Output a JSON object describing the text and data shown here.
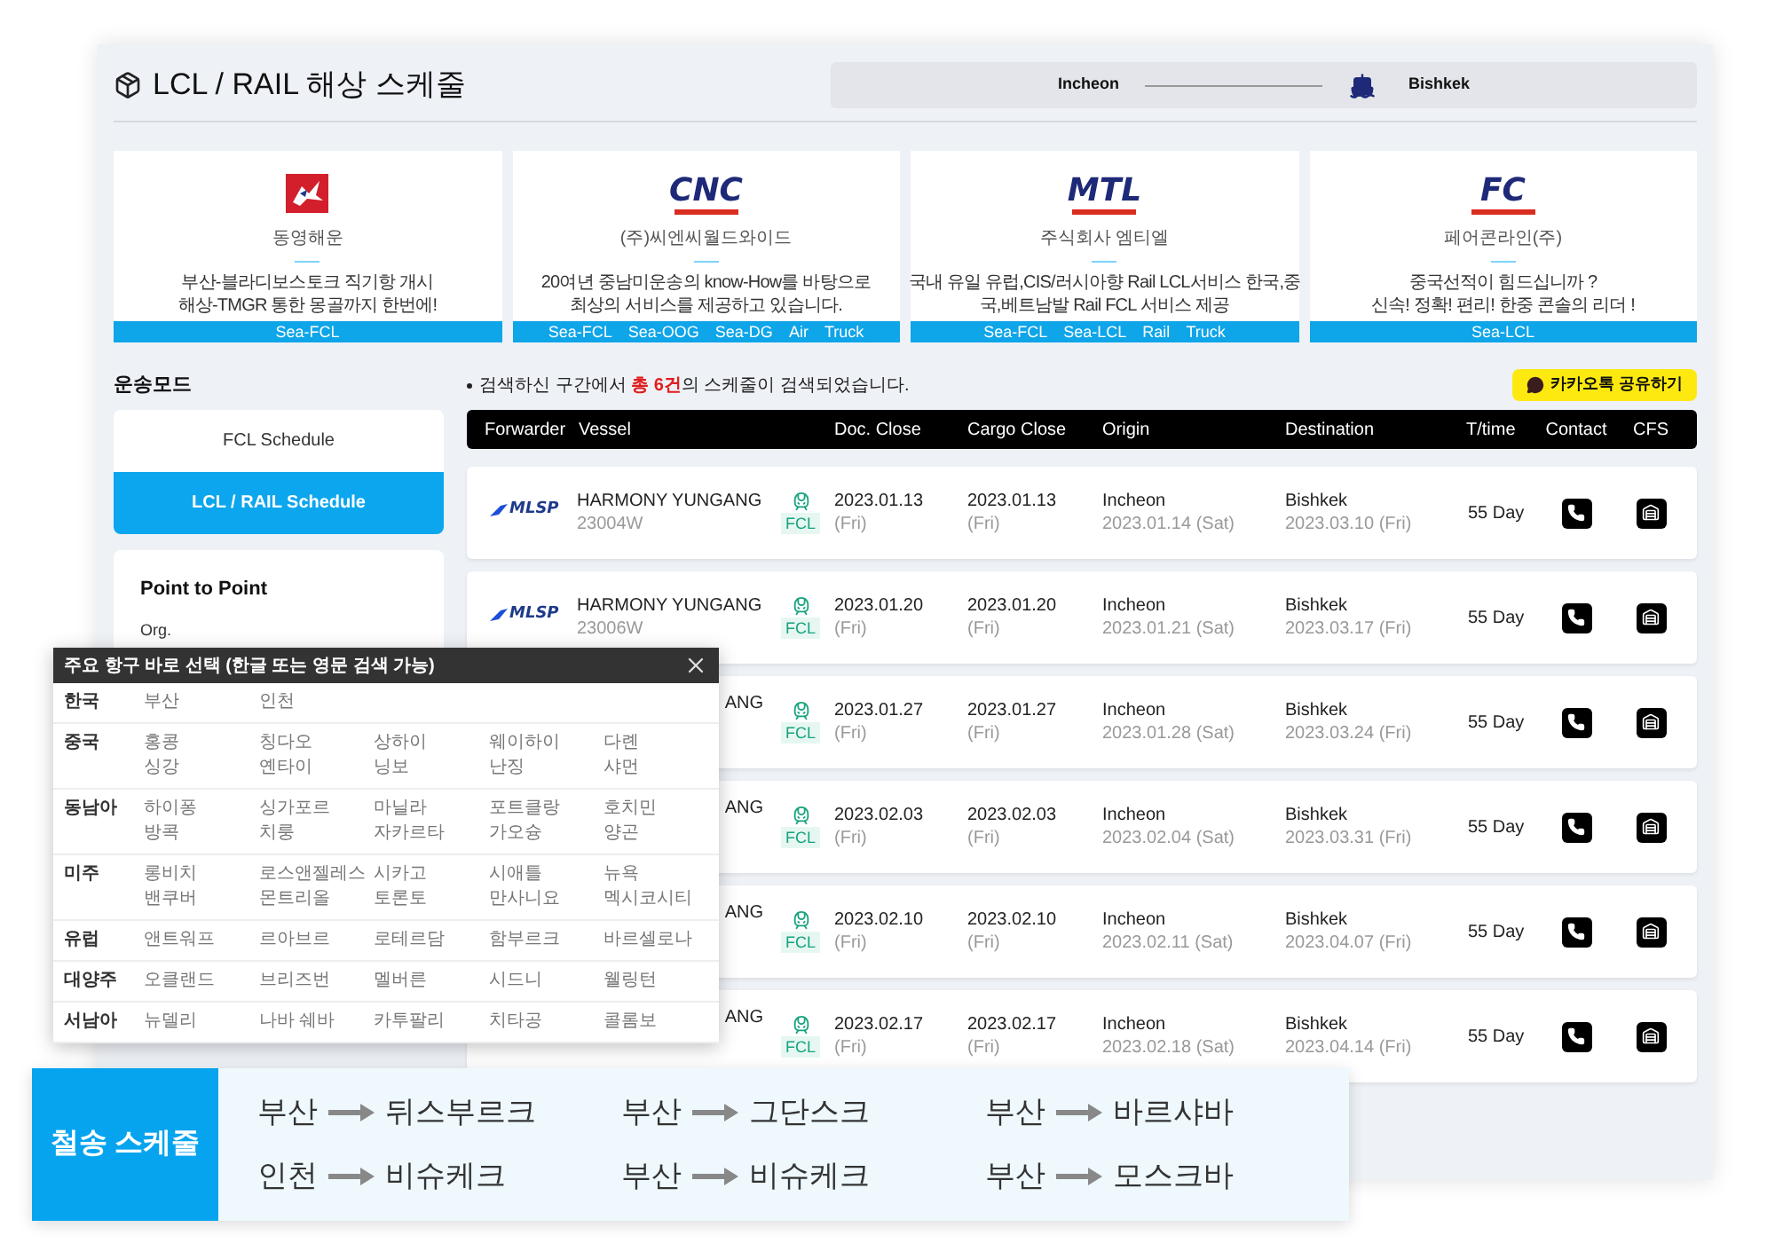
{
  "title": "LCL / RAIL 해상 스케줄",
  "route": {
    "origin": "Incheon",
    "destination": "Bishkek"
  },
  "carriers": [
    {
      "kind": "emblem",
      "name": "동영해운",
      "description": "부산-블라디보스토크 직기항 개시\n해상-TMGR 통한 몽골까지 한번에!",
      "tags": [
        "Sea-FCL"
      ]
    },
    {
      "kind": "wordmark",
      "logo_text": "CNC",
      "name": "(주)씨엔씨월드와이드",
      "description": "20여년 중남미운송의 know-How를 바탕으로\n최상의 서비스를 제공하고 있습니다.",
      "tags": [
        "Sea-FCL",
        "Sea-OOG",
        "Sea-DG",
        "Air",
        "Truck"
      ]
    },
    {
      "kind": "wordmark",
      "logo_text": "MTL",
      "name": "주식회사 엠티엘",
      "description": "국내 유일 유럽,CIS/러시아향 Rail LCL서비스 한국,중\n국,베트남발 Rail FCL 서비스 제공",
      "tags": [
        "Sea-FCL",
        "Sea-LCL",
        "Rail",
        "Truck"
      ]
    },
    {
      "kind": "wordmark",
      "logo_text": "FC",
      "name": "페어콘라인(주)",
      "description": "중국선적이 힘드십니까 ?\n신속! 정확! 편리! 한중 콘솔의 리더 !",
      "tags": [
        "Sea-LCL"
      ]
    }
  ],
  "sidebar": {
    "heading": "운송모드",
    "modes": [
      {
        "label": "FCL Schedule",
        "selected": false
      },
      {
        "label": "LCL / RAIL Schedule",
        "selected": true
      }
    ],
    "panel_title": "Point to Point",
    "panel_label": "Org."
  },
  "results": {
    "notice": {
      "prefix": "검색하신 구간에서 ",
      "count": "총 6건",
      "suffix": "의 스케줄이 검색되었습니다."
    },
    "share_button": "카카오톡 공유하기",
    "columns": [
      "Forwarder",
      "Vessel",
      "",
      "Doc. Close",
      "Cargo Close",
      "Origin",
      "Destination",
      "T/time",
      "Contact",
      "CFS"
    ],
    "rows": [
      {
        "forwarder": "MLSP",
        "vessel": "HARMONY YUNGANG",
        "voyage": "23004W",
        "mode": "FCL",
        "doc_close": "2023.01.13",
        "doc_day": "(Fri)",
        "cargo_close": "2023.01.13",
        "cargo_day": "(Fri)",
        "origin": "Incheon",
        "origin_date": "2023.01.14 (Sat)",
        "destination": "Bishkek",
        "destination_date": "2023.03.10 (Fri)",
        "transit": "55 Day"
      },
      {
        "forwarder": "MLSP",
        "vessel": "HARMONY YUNGANG",
        "voyage": "23006W",
        "mode": "FCL",
        "doc_close": "2023.01.20",
        "doc_day": "(Fri)",
        "cargo_close": "2023.01.20",
        "cargo_day": "(Fri)",
        "origin": "Incheon",
        "origin_date": "2023.01.21 (Sat)",
        "destination": "Bishkek",
        "destination_date": "2023.03.17 (Fri)",
        "transit": "55 Day"
      },
      {
        "vessel": "ANG",
        "mode": "FCL",
        "doc_close": "2023.01.27",
        "doc_day": "(Fri)",
        "cargo_close": "2023.01.27",
        "cargo_day": "(Fri)",
        "origin": "Incheon",
        "origin_date": "2023.01.28 (Sat)",
        "destination": "Bishkek",
        "destination_date": "2023.03.24 (Fri)",
        "transit": "55 Day"
      },
      {
        "vessel": "ANG",
        "mode": "FCL",
        "doc_close": "2023.02.03",
        "doc_day": "(Fri)",
        "cargo_close": "2023.02.03",
        "cargo_day": "(Fri)",
        "origin": "Incheon",
        "origin_date": "2023.02.04 (Sat)",
        "destination": "Bishkek",
        "destination_date": "2023.03.31 (Fri)",
        "transit": "55 Day"
      },
      {
        "vessel": "ANG",
        "mode": "FCL",
        "doc_close": "2023.02.10",
        "doc_day": "(Fri)",
        "cargo_close": "2023.02.10",
        "cargo_day": "(Fri)",
        "origin": "Incheon",
        "origin_date": "2023.02.11 (Sat)",
        "destination": "Bishkek",
        "destination_date": "2023.04.07 (Fri)",
        "transit": "55 Day"
      },
      {
        "vessel": "ANG",
        "mode": "FCL",
        "doc_close": "2023.02.17",
        "doc_day": "(Fri)",
        "cargo_close": "2023.02.17",
        "cargo_day": "(Fri)",
        "origin": "Incheon",
        "origin_date": "2023.02.18 (Sat)",
        "destination": "Bishkek",
        "destination_date": "2023.04.14 (Fri)",
        "transit": "55 Day"
      }
    ]
  },
  "port_picker": {
    "title": "주요 항구 바로 선택 (한글 또는 영문 검색 가능)",
    "regions": [
      {
        "name": "한국",
        "ports": [
          "부산",
          "인천"
        ]
      },
      {
        "name": "중국",
        "ports": [
          "홍콩",
          "칭다오",
          "상하이",
          "웨이하이",
          "다롄",
          "싱강",
          "옌타이",
          "닝보",
          "난징",
          "샤먼"
        ]
      },
      {
        "name": "동남아",
        "ports": [
          "하이퐁",
          "싱가포르",
          "마닐라",
          "포트클랑",
          "호치민",
          "방콕",
          "치룽",
          "자카르타",
          "가오슝",
          "양곤"
        ]
      },
      {
        "name": "미주",
        "ports": [
          "롱비치",
          "로스앤젤레스",
          "시카고",
          "시애틀",
          "뉴욕",
          "밴쿠버",
          "몬트리올",
          "토론토",
          "만사니요",
          "멕시코시티"
        ]
      },
      {
        "name": "유럽",
        "ports": [
          "앤트워프",
          "르아브르",
          "로테르담",
          "함부르크",
          "바르셀로나"
        ]
      },
      {
        "name": "대양주",
        "ports": [
          "오클랜드",
          "브리즈번",
          "멜버른",
          "시드니",
          "웰링턴"
        ]
      },
      {
        "name": "서남아",
        "ports": [
          "뉴델리",
          "나바 쉐바",
          "카투팔리",
          "치타공",
          "콜롬보"
        ]
      }
    ]
  },
  "rail_banner": {
    "title": "철송 스케줄",
    "routes": [
      {
        "from": "부산",
        "to": "뒤스부르크"
      },
      {
        "from": "부산",
        "to": "그단스크"
      },
      {
        "from": "부산",
        "to": "바르샤바"
      },
      {
        "from": "인천",
        "to": "비슈케크"
      },
      {
        "from": "부산",
        "to": "비슈케크"
      },
      {
        "from": "부산",
        "to": "모스크바"
      }
    ]
  }
}
